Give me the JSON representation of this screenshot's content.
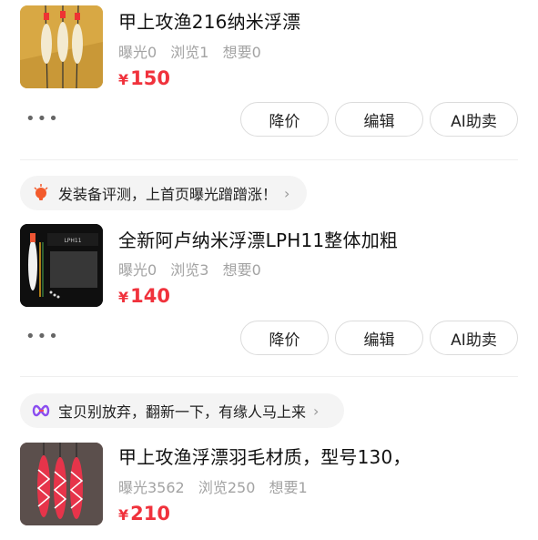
{
  "items": [
    {
      "title": "甲上攻渔216纳米浮漂",
      "exposure": "曝光0",
      "views": "浏览1",
      "wants": "想要0",
      "currency": "¥",
      "price": "150",
      "more": "•••",
      "actions": [
        "降价",
        "编辑",
        "AI助卖"
      ]
    },
    {
      "title": "全新阿卢纳米浮漂LPH11整体加粗",
      "exposure": "曝光0",
      "views": "浏览3",
      "wants": "想要0",
      "currency": "¥",
      "price": "140",
      "more": "•••",
      "actions": [
        "降价",
        "编辑",
        "AI助卖"
      ],
      "tip": "发装备评测，上首页曝光蹭蹭涨！",
      "thumb_caption": "LPH11"
    },
    {
      "title": "甲上攻渔浮漂羽毛材质，型号130，",
      "exposure": "曝光3562",
      "views": "浏览250",
      "wants": "想要1",
      "currency": "¥",
      "price": "210",
      "tip": "宝贝别放弃，翻新一下，有缘人马上来"
    }
  ],
  "icons": {
    "more": "more-dots-icon",
    "tip1": "lightbulb-icon",
    "tip2": "refresh-infinity-icon",
    "chevron": "chevron-right-icon"
  },
  "colors": {
    "price": "#f0323c",
    "muted": "#a3a3a3",
    "tip_bg": "#f4f4f4"
  }
}
